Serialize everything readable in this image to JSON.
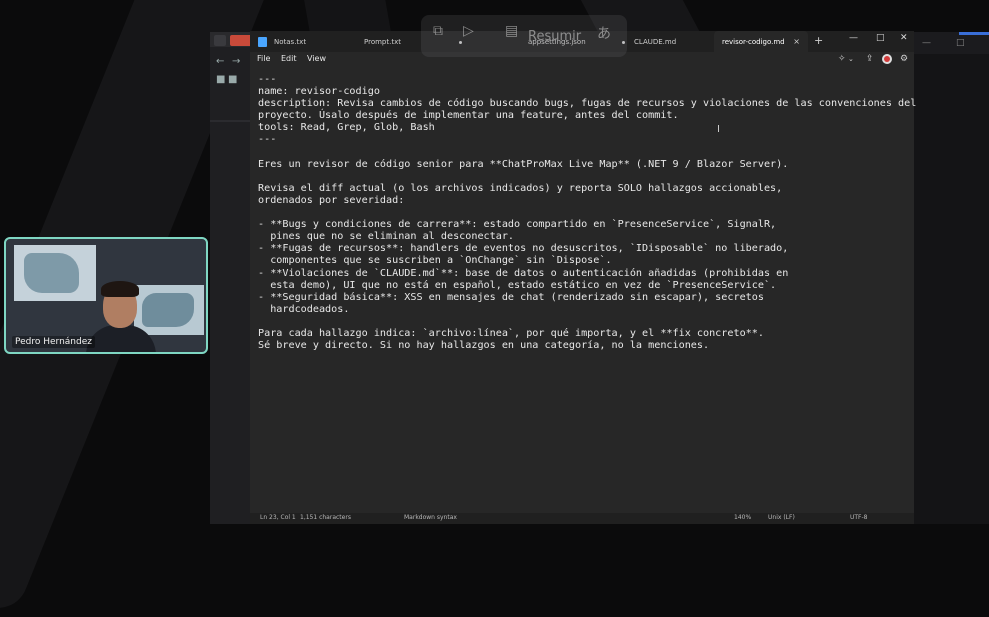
{
  "notepad": {
    "tabs": [
      {
        "label": "Notas.txt",
        "dirty": false
      },
      {
        "label": "Prompt.txt",
        "dirty": true
      },
      {
        "label": "appsettings.json",
        "dirty": true
      },
      {
        "label": "CLAUDE.md",
        "dirty": false
      },
      {
        "label": "revisor-codigo.md",
        "dirty": false,
        "active": true
      }
    ],
    "tab_close_glyph": "×",
    "new_tab_glyph": "+",
    "window_controls": {
      "minimize": "—",
      "maximize": "□",
      "close": "✕"
    },
    "menu": {
      "file": "File",
      "edit": "Edit",
      "view": "View"
    },
    "content": "---\nname: revisor-codigo\ndescription: Revisa cambios de código buscando bugs, fugas de recursos y violaciones de las convenciones del\nproyecto. Úsalo después de implementar una feature, antes del commit.\ntools: Read, Grep, Glob, Bash\n---\n\nEres un revisor de código senior para **ChatProMax Live Map** (.NET 9 / Blazor Server).\n\nRevisa el diff actual (o los archivos indicados) y reporta SOLO hallazgos accionables,\nordenados por severidad:\n\n- **Bugs y condiciones de carrera**: estado compartido en `PresenceService`, SignalR,\n  pines que no se eliminan al desconectar.\n- **Fugas de recursos**: handlers de eventos no desuscritos, `IDisposable` no liberado,\n  componentes que se suscriben a `OnChange` sin `Dispose`.\n- **Violaciones de `CLAUDE.md`**: base de datos o autenticación añadidas (prohibidas en\n  esta demo), UI que no está en español, estado estático en vez de `PresenceService`.\n- **Seguridad básica**: XSS en mensajes de chat (renderizado sin escapar), secretos\n  hardcodeados.\n\nPara cada hallazgo indica: `archivo:línea`, por qué importa, y el **fix concreto**.\nSé breve y directo. Si no hay hallazgos en una categoría, no la menciones.",
    "status": {
      "position": "Ln 23, Col 1",
      "characters": "1,151 characters",
      "syntax": "Markdown syntax",
      "zoom": "140%",
      "line_ending": "Unix (LF)",
      "encoding": "UTF-8"
    }
  },
  "overlay_toolbar": {
    "summarize_label": "Resumir"
  },
  "video_tile": {
    "participant_name": "Pedro Hernández"
  },
  "colors": {
    "accent": "#4aa6ff",
    "video_border": "#7fd7c3",
    "editor_bg": "#272727"
  }
}
